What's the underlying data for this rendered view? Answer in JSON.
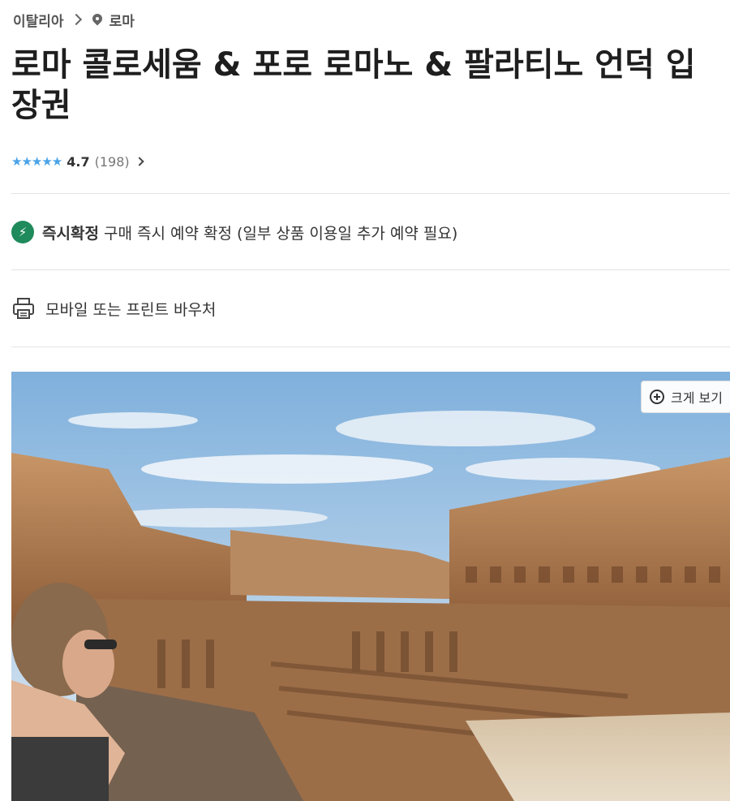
{
  "breadcrumb": {
    "country": "이탈리아",
    "city": "로마"
  },
  "product": {
    "title": "로마 콜로세움 & 포로 로마노 & 팔라티노 언덕 입장권",
    "stars": "★★★★★",
    "rating": "4.7",
    "review_count": "(198)"
  },
  "features": {
    "instant_label": "즉시확정",
    "instant_desc": "구매 즉시 예약 확정 (일부 상품 이용일 추가 예약 필요)",
    "voucher_text": "모바일 또는 프린트 바우처"
  },
  "gallery": {
    "zoom_label": "크게 보기"
  },
  "icons": {
    "location": "pin-icon",
    "instant": "lightning-icon",
    "voucher": "printer-icon",
    "zoom": "plus-circle-icon"
  },
  "colors": {
    "accent_star": "#4aa3e8",
    "instant_green": "#1f8a5b"
  }
}
